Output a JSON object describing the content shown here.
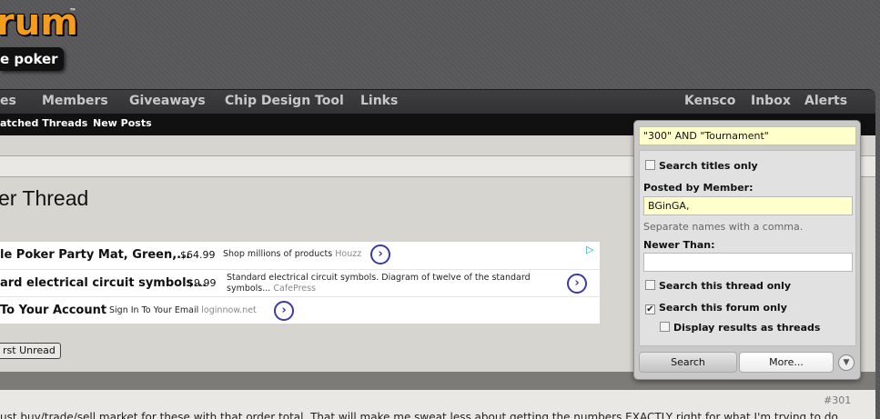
{
  "logo": {
    "main": "rum",
    "tm": "™",
    "sub": "e poker"
  },
  "nav": {
    "items": [
      "es",
      "Members",
      "Giveaways",
      "Chip Design Tool",
      "Links"
    ],
    "user": [
      "Kensco",
      "Inbox",
      "Alerts"
    ]
  },
  "subnav": {
    "items": [
      "atched Threads",
      "New Posts"
    ]
  },
  "thread": {
    "title": "er Thread"
  },
  "ads": [
    {
      "title": "le Poker Party Mat, Green,...",
      "price": "$64.99",
      "desc": "Shop millions of products",
      "source": "Houzz"
    },
    {
      "title": "ard electrical circuit symbols...",
      "price": "$9.99",
      "desc": "Standard electrical circuit symbols. Diagram of twelve of the standard",
      "desc2": "symbols...",
      "source": "CafePress"
    },
    {
      "title": "To Your Account",
      "desc": "Sign In To Your Email",
      "source": "loginnow.net"
    }
  ],
  "unread_button": "rst Unread",
  "post": {
    "number": "#301",
    "text": "ust buy/trade/sell market for these with that order total. That will make me sweat less about getting the numbers EXACTLY right for what I'm trying to do"
  },
  "search": {
    "query": "\"300\" AND \"Tournament\"",
    "titles_only": "Search titles only",
    "posted_by_label": "Posted by Member:",
    "posted_by_value": "BGinGA,",
    "posted_by_hint": "Separate names with a comma.",
    "newer_than_label": "Newer Than:",
    "newer_than_value": "",
    "this_thread": "Search this thread only",
    "this_forum": "Search this forum only",
    "as_threads": "Display results as threads",
    "search_button": "Search",
    "more_button": "More...",
    "checks": {
      "titles_only": false,
      "this_thread": false,
      "this_forum": true,
      "as_threads": false
    }
  }
}
